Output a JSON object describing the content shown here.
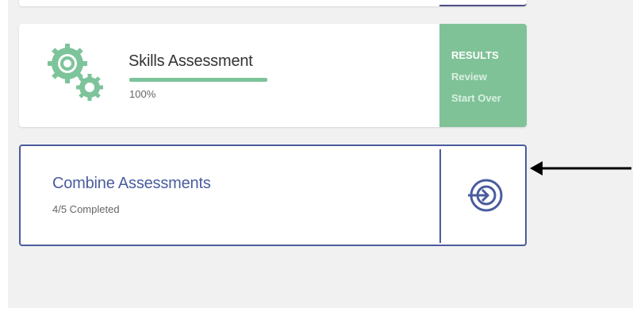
{
  "skills_card": {
    "title": "Skills Assessment",
    "progress_percent": 100,
    "progress_label": "100%",
    "actions": {
      "results": "RESULTS",
      "review": "Review",
      "start_over": "Start Over"
    },
    "icon": "gears-icon"
  },
  "combine_card": {
    "title": "Combine Assessments",
    "subtitle": "4/5 Completed",
    "icon": "enter-icon"
  },
  "annotation": {
    "icon": "arrow-left-icon"
  },
  "colors": {
    "accent_green": "#80c298",
    "accent_blue": "#4a5c9e",
    "panel_bg": "#f1f1f1"
  }
}
